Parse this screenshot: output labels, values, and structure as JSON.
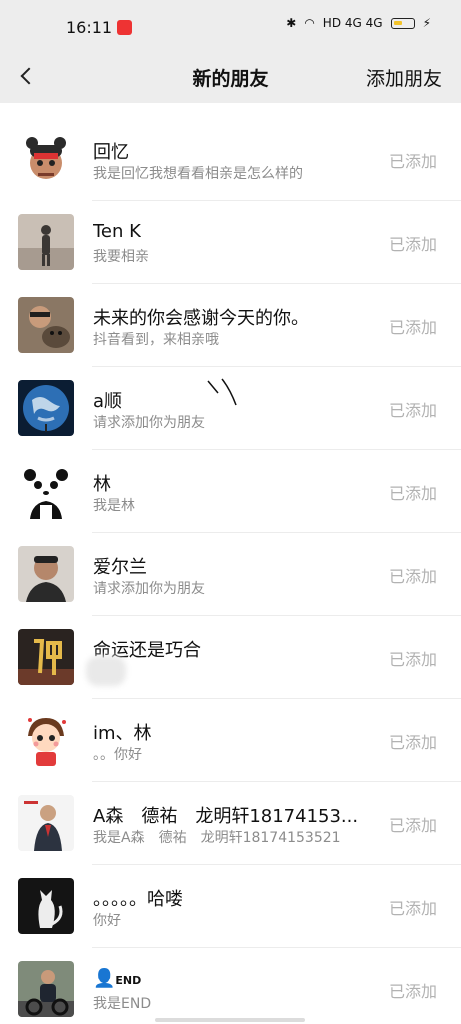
{
  "status_bar": {
    "time": "16:11",
    "indicators": "HD  4G  4G"
  },
  "nav": {
    "title": "新的朋友",
    "action": "添加朋友"
  },
  "requests": [
    {
      "name": "回忆",
      "message": "我是回忆我想看看相亲是怎么样的",
      "status": "已添加",
      "avatar_icon": "cartoon-girl-avatar"
    },
    {
      "name": "Ten K",
      "message": "我要相亲",
      "status": "已添加",
      "avatar_icon": "shadow-photo-avatar"
    },
    {
      "name": "未来的你会感谢今天的你。",
      "message": "抖音看到，来相亲哦",
      "status": "已添加",
      "avatar_icon": "man-with-dog-avatar"
    },
    {
      "name": "a顺",
      "message": "请求添加你为朋友",
      "status": "已添加",
      "avatar_icon": "earth-avatar"
    },
    {
      "name": "林",
      "message": "我是林",
      "status": "已添加",
      "avatar_icon": "panda-avatar"
    },
    {
      "name": "爱尔兰",
      "message": "请求添加你为朋友",
      "status": "已添加",
      "avatar_icon": "man-portrait-avatar"
    },
    {
      "name": "命运还是巧合",
      "message": "相亲",
      "status": "已添加",
      "avatar_icon": "buddha-character-avatar"
    },
    {
      "name": "im、林",
      "message": "。。你好",
      "status": "已添加",
      "avatar_icon": "cartoon-boy-avatar"
    },
    {
      "name": "A森　德祐　龙明轩18174153...",
      "message": "我是A森　德祐　龙明轩18174153521",
      "status": "已添加",
      "avatar_icon": "suited-man-avatar"
    },
    {
      "name": "。。。。。哈喽",
      "message": "你好",
      "status": "已添加",
      "avatar_icon": "cat-sketch-avatar"
    },
    {
      "name": "END",
      "message": "我是END",
      "status": "已添加",
      "avatar_icon": "man-on-bike-avatar"
    }
  ]
}
